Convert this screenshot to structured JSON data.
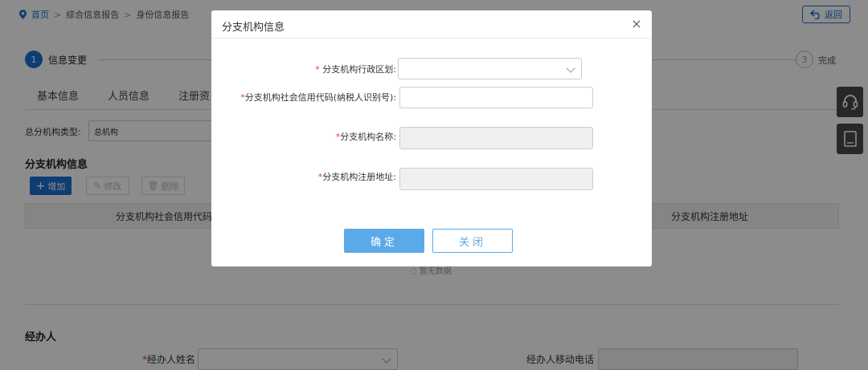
{
  "breadcrumb": {
    "home": "首页",
    "sep": ">",
    "level2": "综合信息报告",
    "level3": "身份信息报告"
  },
  "back_button": "返回",
  "steps": {
    "step1_number": "1",
    "step1_label": "信息变更",
    "step3_number": "3",
    "step3_label": "完成"
  },
  "tabs": [
    "基本信息",
    "人员信息",
    "注册资"
  ],
  "org_type": {
    "label": "总分机构类型:",
    "value": "总机构"
  },
  "branch_section": {
    "title": "分支机构信息",
    "add_label": "增加",
    "edit_label": "修改",
    "delete_label": "删除",
    "columns": [
      "分支机构社会信用代码",
      "分支机构注册地址"
    ],
    "empty_text": "暂无数据"
  },
  "agent_section": {
    "title": "经办人",
    "name_label": "经办人姓名",
    "phone_label": "经办人移动电话"
  },
  "modal": {
    "title": "分支机构信息",
    "close_icon": "×",
    "fields": [
      {
        "label": "分支机构行政区划:",
        "required": true,
        "type": "select",
        "value": ""
      },
      {
        "label": "分支机构社会信用代码(纳税人识别号):",
        "required": true,
        "type": "input",
        "value": ""
      },
      {
        "label": "分支机构名称:",
        "required": true,
        "type": "input-disabled",
        "value": ""
      },
      {
        "label": "分支机构注册地址:",
        "required": true,
        "type": "input-disabled",
        "value": ""
      }
    ],
    "required_mark": "*",
    "ok_label": "确定",
    "close_label": "关闭"
  },
  "colors": {
    "accent": "#1b6fd1",
    "modal_primary": "#5ca9e8",
    "required": "#e03a3a",
    "side_icon_bg": "#4a4a4a"
  },
  "icons": [
    "location-pin-icon",
    "back-arrow-icon",
    "headset-icon",
    "book-icon",
    "plus-icon",
    "pencil-icon",
    "trash-icon",
    "chevron-down-icon",
    "close-icon",
    "empty-icon"
  ]
}
